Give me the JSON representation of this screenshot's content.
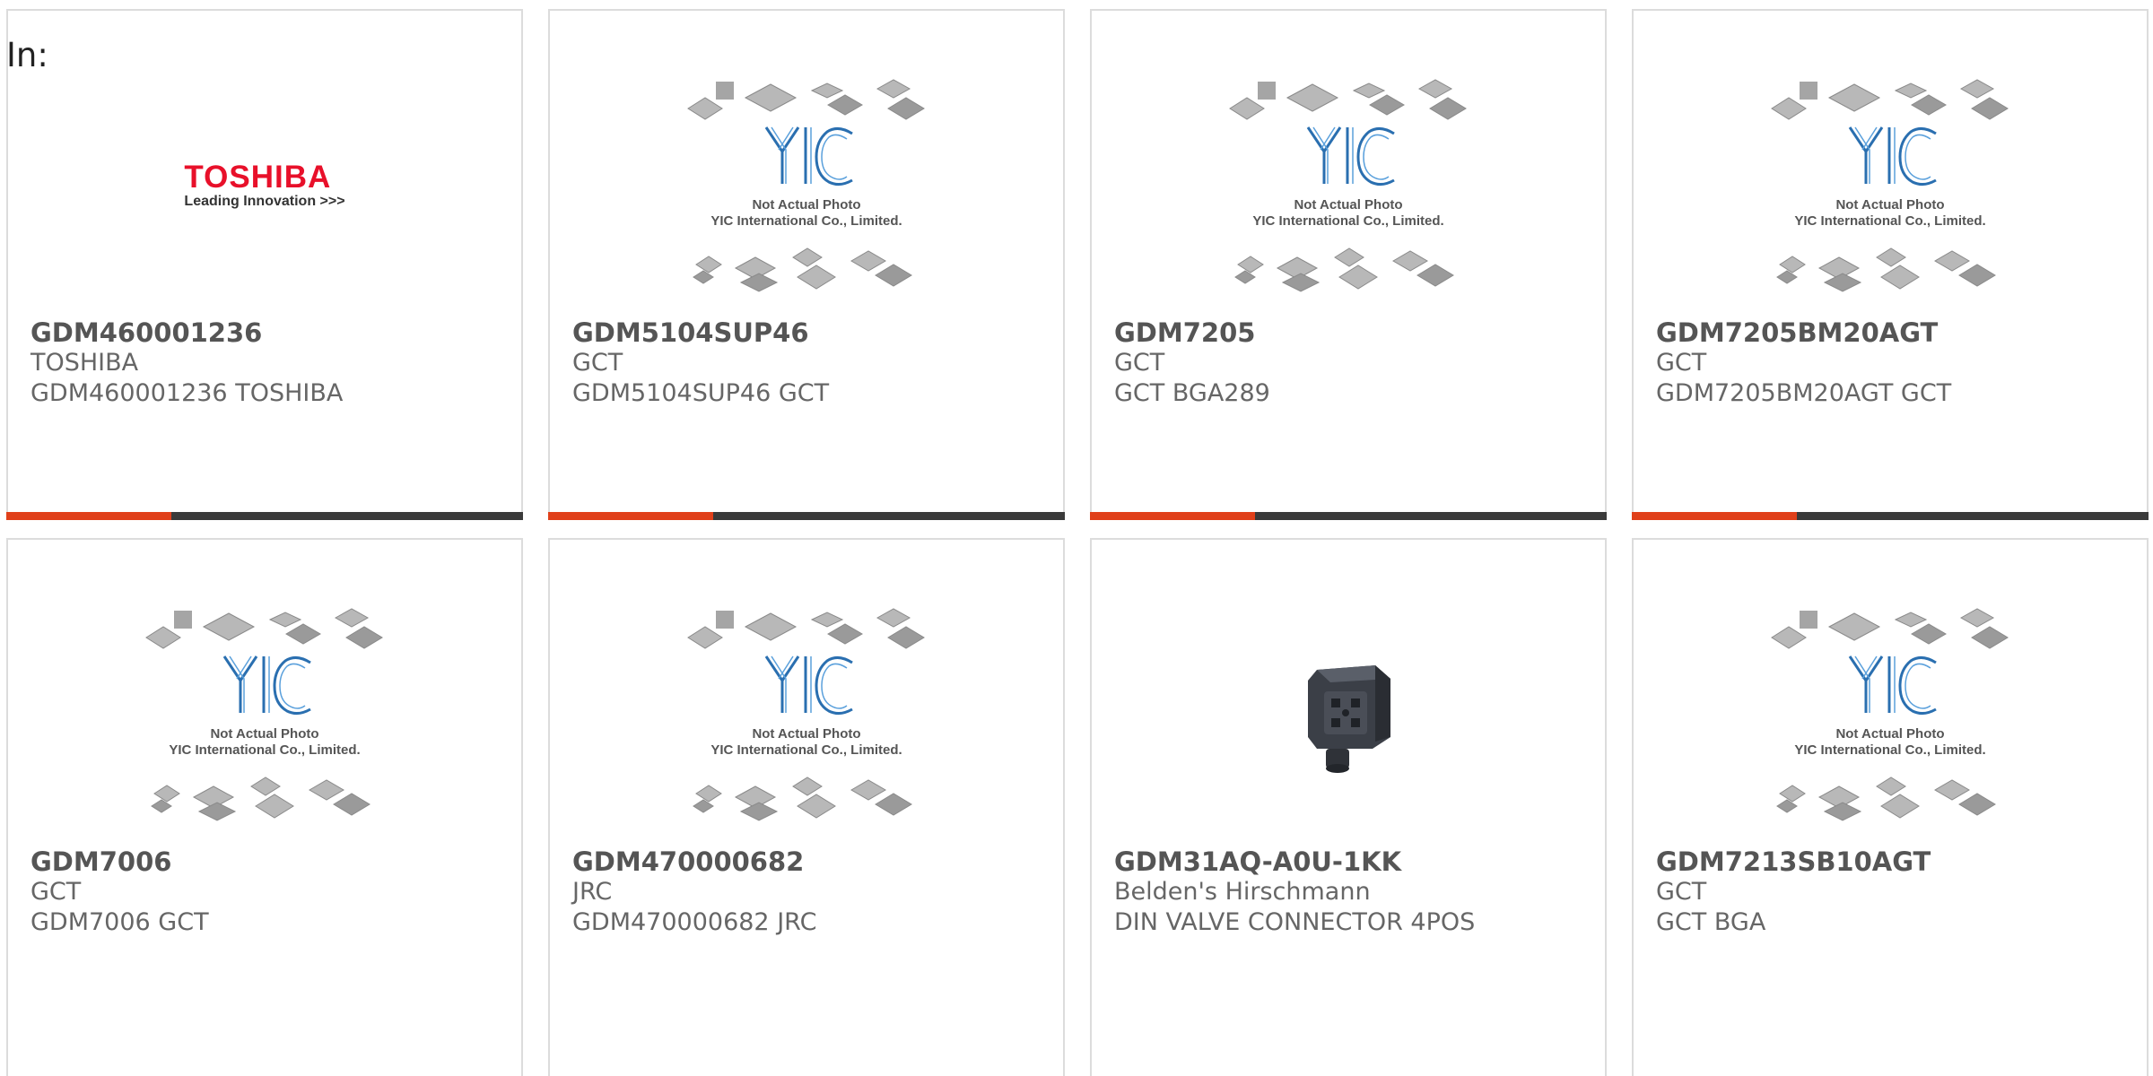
{
  "filter_label": "In:",
  "colors": {
    "accent": "#e0401a",
    "bar": "#3a3a3a",
    "border": "#dcdcdc",
    "toshiba_red": "#e8102a"
  },
  "placeholder": {
    "line1": "Not Actual Photo",
    "line2": "YIC International Co., Limited.",
    "logo_text": "YIC"
  },
  "toshiba_logo": {
    "brand": "TOSHIBA",
    "tagline": "Leading Innovation >>>"
  },
  "products": [
    {
      "part_number": "GDM460001236",
      "manufacturer": "TOSHIBA",
      "description": "GDM460001236 TOSHIBA",
      "image": "toshiba-logo"
    },
    {
      "part_number": "GDM5104SUP46",
      "manufacturer": "GCT",
      "description": "GDM5104SUP46 GCT",
      "image": "placeholder"
    },
    {
      "part_number": "GDM7205",
      "manufacturer": "GCT",
      "description": "GCT BGA289",
      "image": "placeholder"
    },
    {
      "part_number": "GDM7205BM20AGT",
      "manufacturer": "GCT",
      "description": "GDM7205BM20AGT GCT",
      "image": "placeholder"
    },
    {
      "part_number": "GDM7006",
      "manufacturer": "GCT",
      "description": "GDM7006 GCT",
      "image": "placeholder"
    },
    {
      "part_number": "GDM470000682",
      "manufacturer": "JRC",
      "description": "GDM470000682 JRC",
      "image": "placeholder"
    },
    {
      "part_number": "GDM31AQ-A0U-1KK",
      "manufacturer": "Belden's Hirschmann",
      "description": "DIN VALVE CONNECTOR 4POS",
      "image": "connector-photo"
    },
    {
      "part_number": "GDM7213SB10AGT",
      "manufacturer": "GCT",
      "description": "GCT BGA",
      "image": "placeholder"
    }
  ]
}
